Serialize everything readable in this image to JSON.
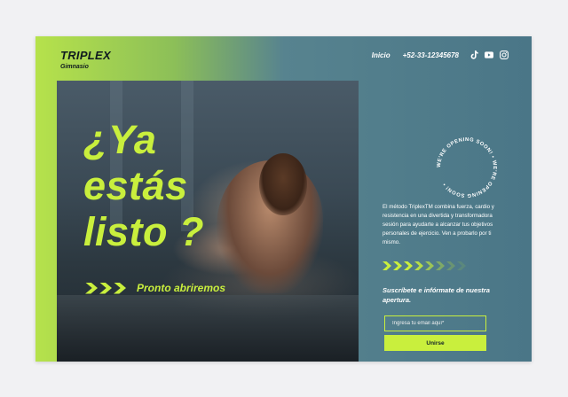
{
  "brand": {
    "name": "TRIPLEX",
    "subtitle": "Gimnasio"
  },
  "nav": {
    "home": "Inicio",
    "phone": "+52-33-12345678",
    "social_icons": [
      "tiktok-icon",
      "youtube-icon",
      "instagram-icon"
    ]
  },
  "hero": {
    "line1": "¿Ya",
    "line2": "estás",
    "line3": "listo ?",
    "soon": "Pronto abriremos"
  },
  "badge": {
    "text": "WE'RE OPENING SOON! • WE'RE OPENING SOON! • "
  },
  "description": "El método TriplexTM combina fuerza, cardio y resistencia en una divertida y transformadora sesión para ayudarte a alcanzar tus objetivos personales de ejercicio. Ven a probarlo por ti mismo.",
  "subscribe": {
    "heading": "Suscríbete e infórmate de nuestra apertura."
  },
  "form": {
    "email_placeholder": "Ingresa tu email aquí*",
    "button": "Unirse"
  },
  "colors": {
    "accent": "#c9ef3d",
    "panel": "#4a7687",
    "dark": "#0f1a1f"
  }
}
